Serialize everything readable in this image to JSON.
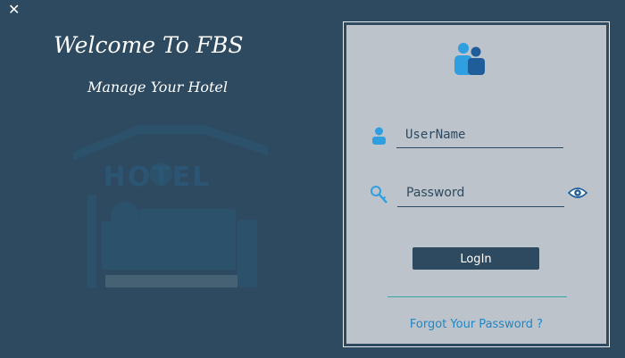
{
  "window": {
    "close_glyph": "✕"
  },
  "welcome": {
    "title": "Welcome To FBS",
    "tagline": "Manage Your Hotel"
  },
  "hotel_art": {
    "sign_text": "HOTEL"
  },
  "login": {
    "username_placeholder": "UserName",
    "password_placeholder": "Password",
    "login_label": "LogIn",
    "forgot_label": "Forgot Your Password ?"
  },
  "colors": {
    "background": "#2e4a60",
    "panel": "#bcc3ca",
    "accent_blue": "#1f86c7",
    "divider": "#3aa7a7"
  },
  "icons": {
    "close": "close-icon",
    "logo": "users-group-icon",
    "username": "user-icon",
    "password": "key-icon",
    "show_password": "eye-icon"
  }
}
